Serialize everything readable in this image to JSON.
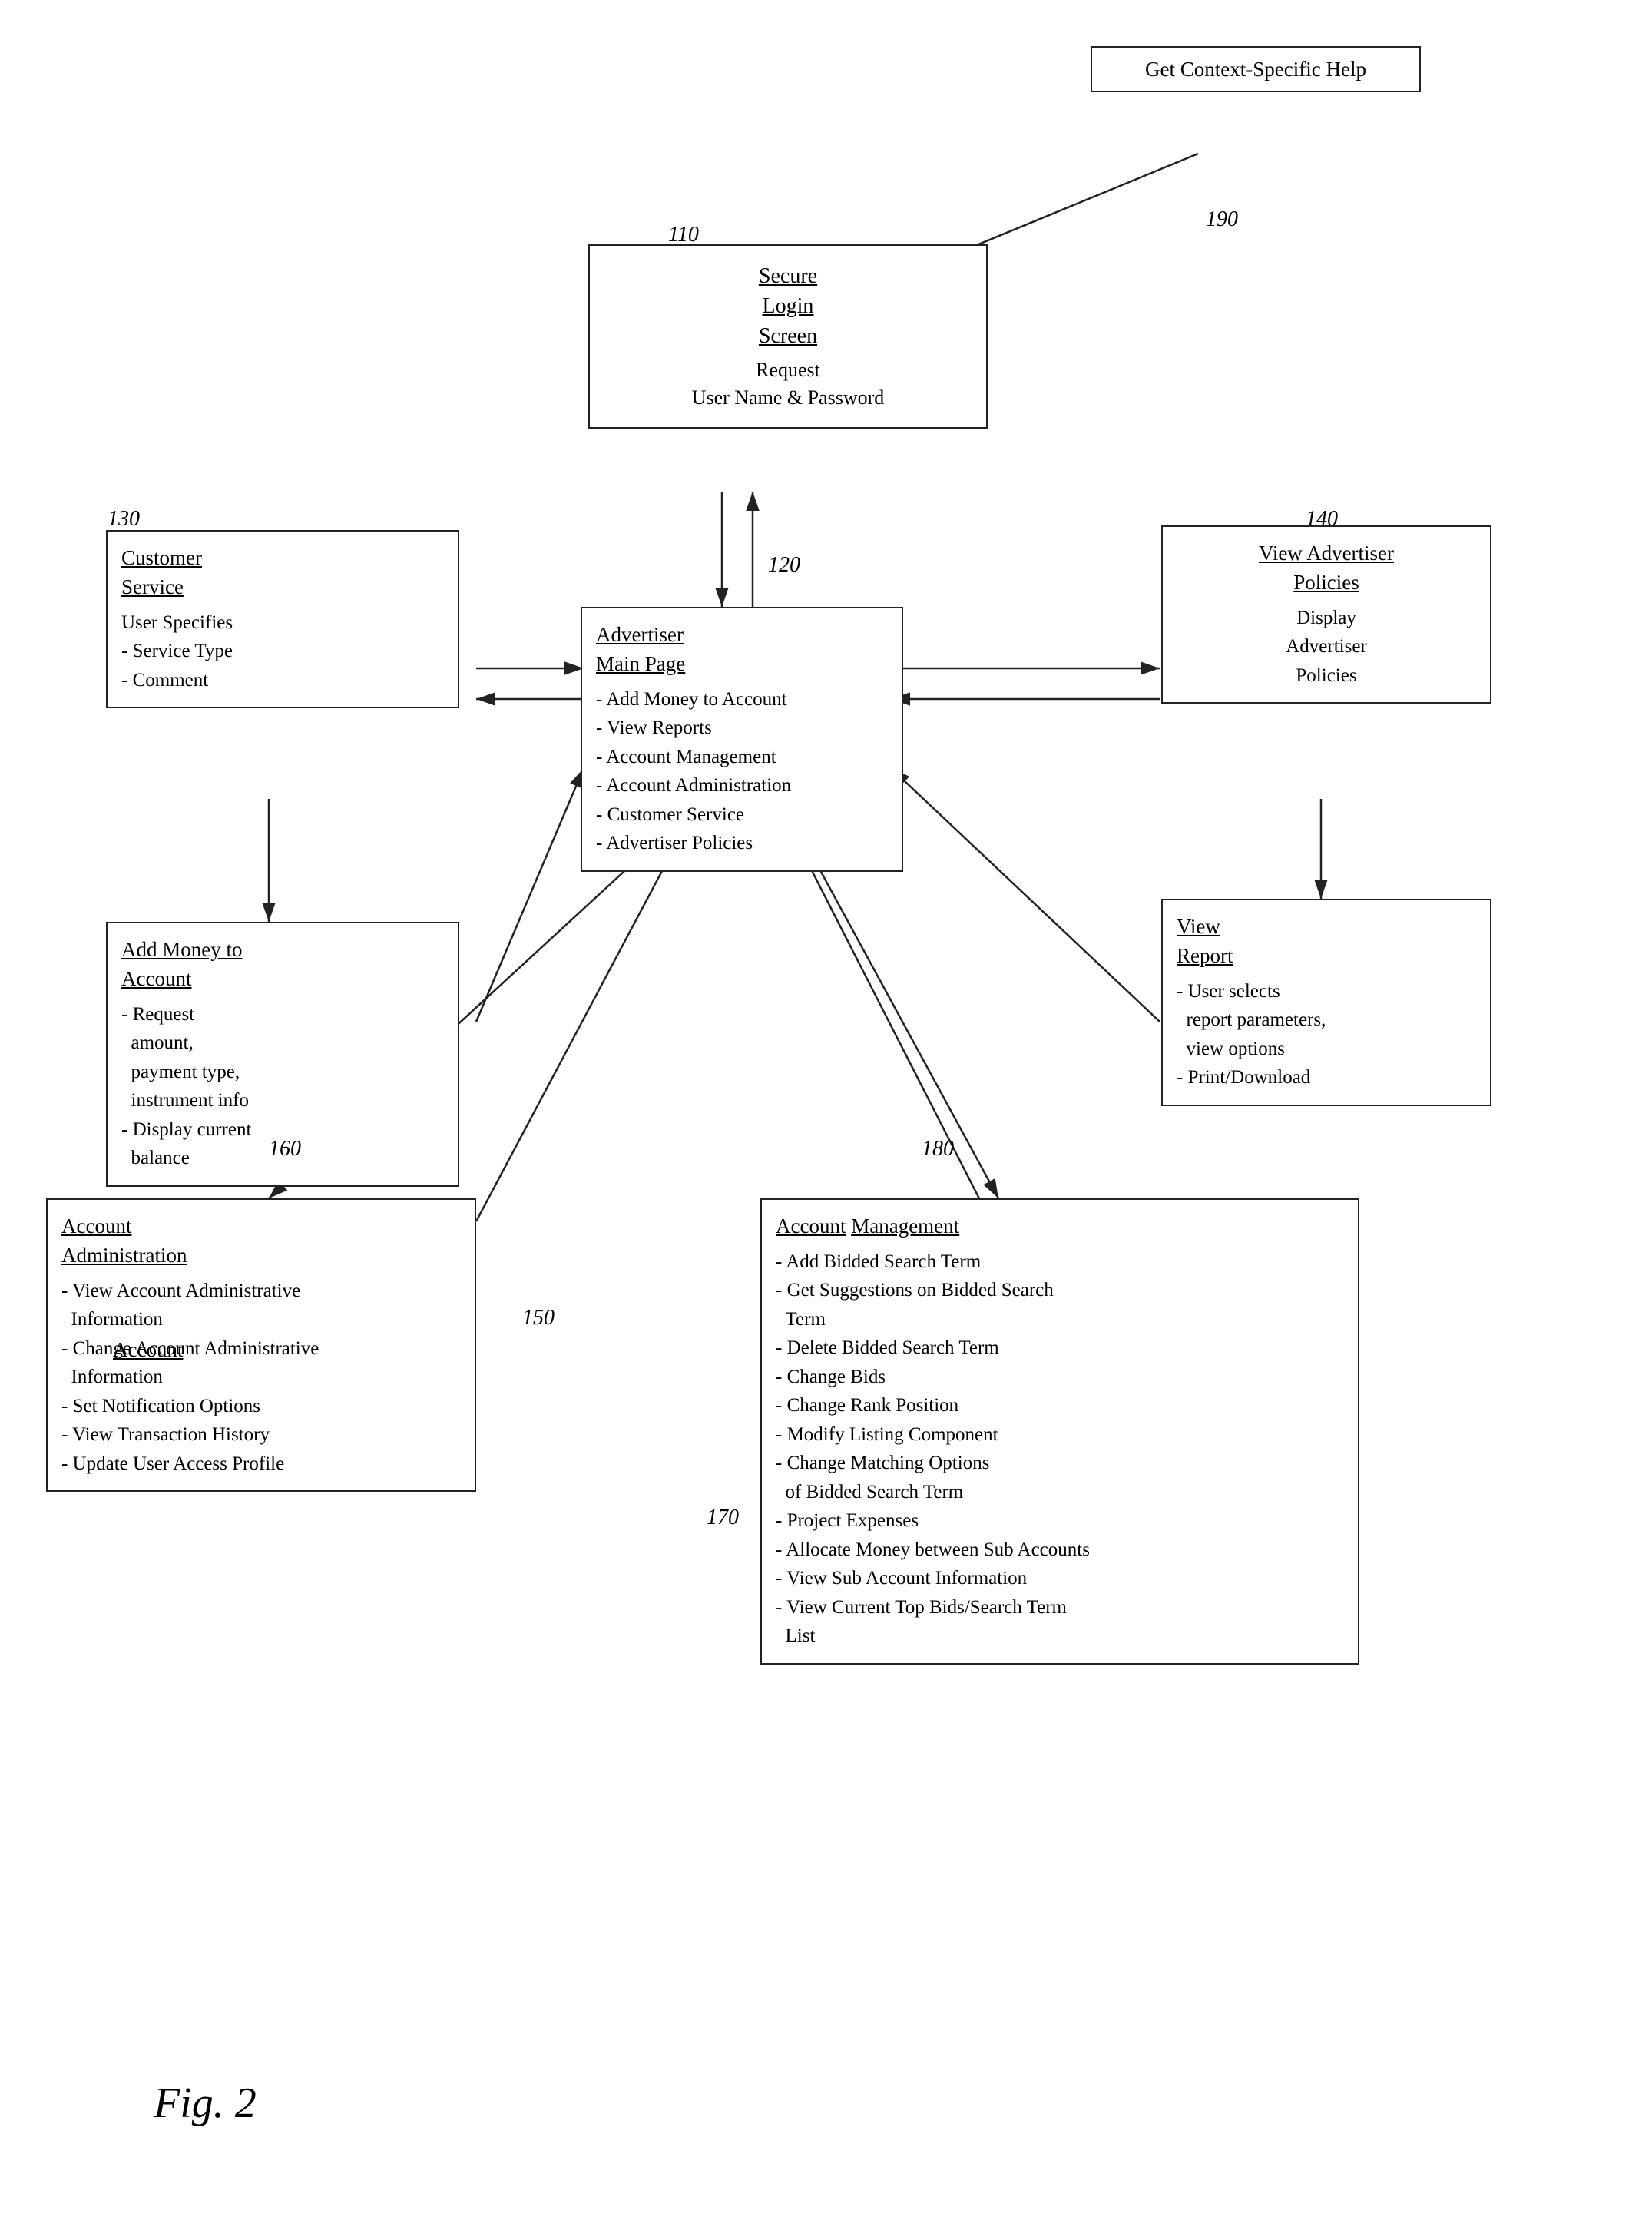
{
  "diagram": {
    "title": "Fig. 2",
    "boxes": {
      "help": {
        "id": "help",
        "title": "Get Context-Specific Help",
        "content": ""
      },
      "login": {
        "id": "login",
        "title": "Secure\nLogin\nScreen",
        "content": "Request\nUser Name & Password"
      },
      "advertiserMain": {
        "id": "advertiserMain",
        "title": "Advertiser\nMain Page",
        "content": "- Add Money to Account\n- View Reports\n- Account Management\n- Account Administration\n- Customer Service\n- Advertiser Policies"
      },
      "customerService": {
        "id": "customerService",
        "title": "Customer\nService",
        "content": "User Specifies\n- Service Type\n- Comment"
      },
      "viewAdvertiserPolicies": {
        "id": "viewAdvertiserPolicies",
        "title": "View Advertiser\nPolicies",
        "content": "Display\nAdvertiser\nPolicies"
      },
      "addMoney": {
        "id": "addMoney",
        "title": "Add Money to\nAccount",
        "content": "- Request\n  amount,\n  payment type,\n  instrument info\n- Display current\n  balance"
      },
      "viewReport": {
        "id": "viewReport",
        "title": "View\nReport",
        "content": "- User selects\n  report parameters,\n  view options\n- Print/Download"
      },
      "accountAdministration": {
        "id": "accountAdministration",
        "title": "Account\nAdministration",
        "content": "- View Account Administrative\n  Information\n- Change Account Administrative\n  Information\n- Set Notification Options\n- View Transaction History\n- Update User Access Profile"
      },
      "accountManagement": {
        "id": "accountManagement",
        "title": "Account Management",
        "content": "- Add Bidded Search Term\n- Get Suggestions on Bidded Search\n  Term\n- Delete Bidded Search Term\n- Change Bids\n- Change Rank Position\n- Modify Listing Component\n- Change Matching Options\n  of Bidded Search Term\n- Project Expenses\n- Allocate Money between Sub Accounts\n- View Sub Account Information\n- View Current Top Bids/Search Term\n  List"
      }
    },
    "labels": {
      "n110": "110",
      "n120": "120",
      "n130": "130",
      "n140": "140",
      "n150": "150",
      "n160": "160",
      "n170": "170",
      "n180": "180",
      "n190": "190"
    }
  }
}
